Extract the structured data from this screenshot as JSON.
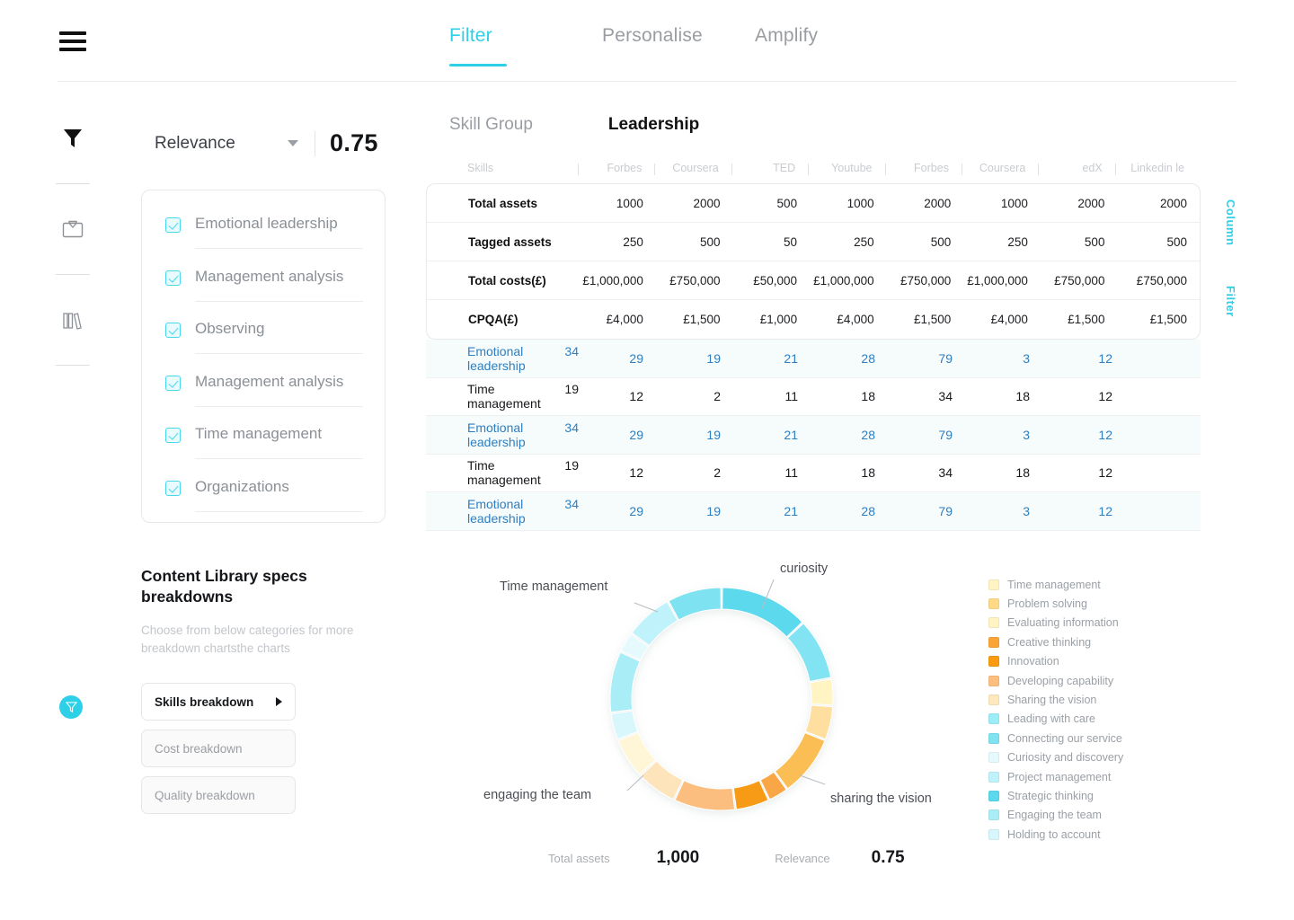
{
  "header": {
    "menu_icon": "hamburger-icon",
    "tabs": [
      {
        "label": "Filter",
        "active": true
      },
      {
        "label": "Personalise",
        "active": false
      },
      {
        "label": "Amplify",
        "active": false
      }
    ]
  },
  "rail": {
    "items": [
      {
        "icon": "funnel-icon",
        "name": "filter"
      },
      {
        "icon": "briefcase-icon",
        "name": "briefcase"
      },
      {
        "icon": "books-icon",
        "name": "library"
      }
    ]
  },
  "relevance": {
    "label": "Relevance",
    "value": "0.75"
  },
  "filters": {
    "items": [
      {
        "label": "Emotional leadership",
        "checked": true
      },
      {
        "label": "Management analysis",
        "checked": true
      },
      {
        "label": "Observing",
        "checked": true
      },
      {
        "label": "Management analysis",
        "checked": true
      },
      {
        "label": "Time management",
        "checked": true
      },
      {
        "label": "Organizations",
        "checked": true
      }
    ]
  },
  "content_library": {
    "title": "Content Library specs breakdowns",
    "subtitle": "Choose from below categories for  more breakdown chartsthe charts",
    "fab_icon": "funnel-icon",
    "buttons": [
      {
        "label": "Skills breakdown",
        "selected": true
      },
      {
        "label": "Cost breakdown",
        "selected": false
      },
      {
        "label": "Quality breakdown",
        "selected": false
      }
    ]
  },
  "skill_group": {
    "label": "Skill Group",
    "value": "Leadership"
  },
  "side_tabs": [
    {
      "label": "Column"
    },
    {
      "label": "Filter"
    }
  ],
  "table": {
    "columns": [
      "Skills",
      "Forbes",
      "Coursera",
      "TED",
      "Youtube",
      "Forbes",
      "Coursera",
      "edX",
      "Linkedin le"
    ],
    "summary_rows": [
      {
        "label": "Total assets",
        "values": [
          "1000",
          "2000",
          "500",
          "1000",
          "2000",
          "1000",
          "2000",
          "2000"
        ]
      },
      {
        "label": "Tagged assets",
        "values": [
          "250",
          "500",
          "50",
          "250",
          "500",
          "250",
          "500",
          "500"
        ]
      },
      {
        "label": "Total costs(£)",
        "values": [
          "£1,000,000",
          "£750,000",
          "£50,000",
          "£1,000,000",
          "£750,000",
          "£1,000,000",
          "£750,000",
          "£750,000"
        ]
      },
      {
        "label": "CPQA(£)",
        "values": [
          "£4,000",
          "£1,500",
          "£1,000",
          "£4,000",
          "£1,500",
          "£4,000",
          "£1,500",
          "£1,500"
        ]
      }
    ],
    "data_rows": [
      {
        "label": "Emotional leadership",
        "values": [
          "34",
          "29",
          "19",
          "21",
          "28",
          "79",
          "3",
          "12"
        ],
        "highlight": true
      },
      {
        "label": "Time management",
        "values": [
          "19",
          "12",
          "2",
          "11",
          "18",
          "34",
          "18",
          "12"
        ],
        "highlight": false
      },
      {
        "label": "Emotional leadership",
        "values": [
          "34",
          "29",
          "19",
          "21",
          "28",
          "79",
          "3",
          "12"
        ],
        "highlight": true
      },
      {
        "label": "Time management",
        "values": [
          "19",
          "12",
          "2",
          "11",
          "18",
          "34",
          "18",
          "12"
        ],
        "highlight": false
      },
      {
        "label": "Emotional leadership",
        "values": [
          "34",
          "29",
          "19",
          "21",
          "28",
          "79",
          "3",
          "12"
        ],
        "highlight": true
      }
    ]
  },
  "donut_labels": [
    {
      "text": "Time management"
    },
    {
      "text": "curiosity"
    },
    {
      "text": "engaging the team"
    },
    {
      "text": "sharing the vision"
    }
  ],
  "legend": [
    {
      "label": "Time management",
      "color": "#FFF4C2"
    },
    {
      "label": "Problem solving",
      "color": "#FFD98A"
    },
    {
      "label": "Evaluating information",
      "color": "#FFC martial"
    },
    {
      "label": "Creative thinking",
      "color": "#FBA436"
    },
    {
      "label": "Innovation",
      "color": "#F89B10"
    },
    {
      "label": "Developing capability",
      "color": "#FBBE7E"
    },
    {
      "label": "Sharing the vision",
      "color": "#FEE9BE"
    },
    {
      "label": "Leading with care",
      "color": "#9DEDF7"
    },
    {
      "label": "Connecting our service",
      "color": "#7FE2F0"
    },
    {
      "label": "Curiosity and discovery",
      "color": "#E6FAFD"
    },
    {
      "label": "Project management",
      "color": "#BFF2FA"
    },
    {
      "label": "Strategic thinking",
      "color": "#5BD9EC"
    },
    {
      "label": "Engaging the team",
      "color": "#A9EDF7"
    },
    {
      "label": "Holding to account",
      "color": "#D8F7FC"
    }
  ],
  "stats": [
    {
      "label": "Total assets",
      "value": "1,000"
    },
    {
      "label": "Relevance",
      "value": "0.75"
    }
  ],
  "chart_data": {
    "type": "pie",
    "title": "",
    "subtype": "donut",
    "legend_position": "right",
    "categories": [
      "Strategic thinking",
      "Leading with care",
      "Time management",
      "Problem solving",
      "Evaluating information",
      "Creative thinking",
      "Innovation",
      "Developing capability",
      "Sharing the vision",
      "Time management 2",
      "Holding to account",
      "Engaging the team",
      "Curiosity and discovery",
      "Project management",
      "Connecting our service"
    ],
    "values": [
      13,
      9,
      4,
      5,
      9,
      3,
      5,
      9,
      6,
      6,
      4,
      9,
      3,
      7,
      8
    ],
    "colors": [
      "#5BD9EC",
      "#82E4F2",
      "#FFF4C2",
      "#FFDFA0",
      "#FBBE55",
      "#F9A646",
      "#F79A18",
      "#FBBE7E",
      "#FEE4BB",
      "#FFF6D8",
      "#D8F7FC",
      "#A9EDF7",
      "#E6FAFD",
      "#BFF2FA",
      "#7FE2F0"
    ],
    "annotations": [
      "Time management",
      "curiosity",
      "engaging the team",
      "sharing the vision"
    ]
  }
}
